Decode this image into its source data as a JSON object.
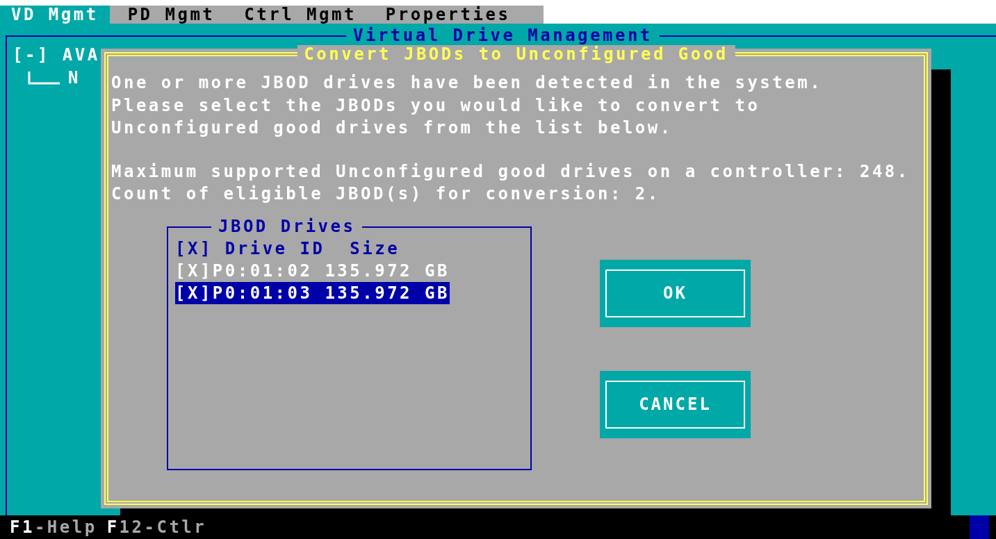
{
  "menu": [
    {
      "label": "VD Mgmt",
      "selected": true
    },
    {
      "label": "PD Mgmt",
      "selected": false
    },
    {
      "label": "Ctrl Mgmt",
      "selected": false
    },
    {
      "label": "Properties",
      "selected": false
    }
  ],
  "panel": {
    "title": "Virtual Drive Management",
    "tree": [
      {
        "label": "[-] AVA",
        "children": [
          {
            "label": "N"
          }
        ]
      }
    ]
  },
  "dialog": {
    "title": "Convert JBODs to Unconfigured Good",
    "paragraphs": [
      {
        "lines": [
          "One or more JBOD drives have been detected in the system.",
          "Please select the JBODs you would like to convert to",
          "Unconfigured good drives from the list below."
        ]
      },
      {
        "lines": [
          "Maximum supported Unconfigured good drives on a controller: 248.",
          "Count of eligible JBOD(s) for conversion: 2."
        ]
      }
    ],
    "list": {
      "title": "JBOD Drives",
      "header": "[X] Drive ID  Size",
      "rows": [
        {
          "text": "[X]P0:01:02 135.972 GB",
          "selected": false
        },
        {
          "text": "[X]P0:01:03 135.972 GB",
          "selected": true
        }
      ]
    },
    "buttons": [
      "OK",
      "CANCEL"
    ]
  },
  "status_bar": [
    {
      "key": "F1",
      "label": "-Help"
    },
    {
      "key": "F",
      "label": "12-Ctlr"
    }
  ]
}
